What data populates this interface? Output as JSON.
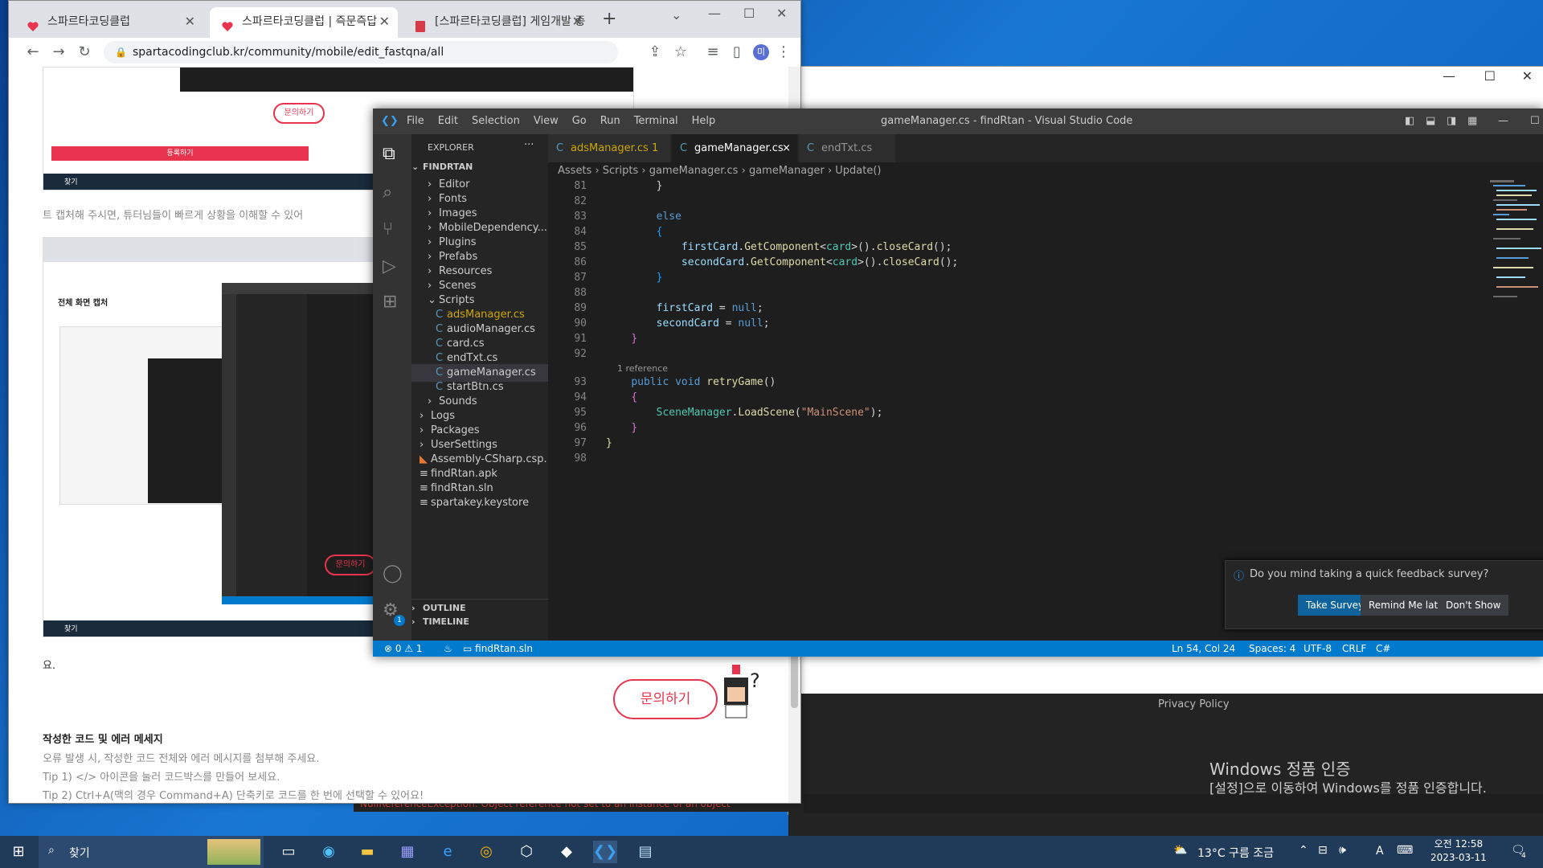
{
  "browser": {
    "tabs": [
      {
        "title": "스파르타코딩클럽"
      },
      {
        "title": "스파르타코딩클럽 | 즉문즉답"
      },
      {
        "title": "[스파르타코딩클럽] 게임개발 종"
      }
    ],
    "new_tab": "+",
    "url": "spartacodingclub.kr/community/mobile/edit_fastqna/all",
    "profile_initial": "미"
  },
  "page": {
    "caption_text": "트 캡처해 주시면, 튜터님들이 빠르게 상황을 이해할 수 있어",
    "small_inquiry": "문의하기",
    "register_button": "등록하기",
    "fragment_text": "요.",
    "inquiry_button": "문의하기",
    "section_title": "작성한 코드 및 에러 메세지",
    "lines": [
      "오류 발생 시, 작성한 코드 전체와 에러 메시지를 첨부해 주세요.",
      "Tip 1) </> 아이콘을 눌러 코드박스를 만들어 보세요.",
      "Tip 2) Ctrl+A(맥의 경우 Command+A) 단축키로 코드를 한 번에 선택할 수 있어요!"
    ],
    "nested_shot_title": "전체 화면 캡처",
    "mini_search": "찾기"
  },
  "vscode": {
    "title": "gameManager.cs - findRtan - Visual Studio Code",
    "menu": [
      "File",
      "Edit",
      "Selection",
      "View",
      "Go",
      "Run",
      "Terminal",
      "Help"
    ],
    "explorer_label": "EXPLORER",
    "explorer_more": "···",
    "project": "FINDRTAN",
    "tree": [
      {
        "label": "Editor",
        "indent": 2,
        "type": "folder"
      },
      {
        "label": "Fonts",
        "indent": 2,
        "type": "folder"
      },
      {
        "label": "Images",
        "indent": 2,
        "type": "folder"
      },
      {
        "label": "MobileDependency...",
        "indent": 2,
        "type": "folder"
      },
      {
        "label": "Plugins",
        "indent": 2,
        "type": "folder"
      },
      {
        "label": "Prefabs",
        "indent": 2,
        "type": "folder"
      },
      {
        "label": "Resources",
        "indent": 2,
        "type": "folder"
      },
      {
        "label": "Scenes",
        "indent": 2,
        "type": "folder"
      },
      {
        "label": "Scripts",
        "indent": 2,
        "type": "open-folder"
      },
      {
        "label": "adsManager.cs",
        "indent": 3,
        "type": "cs",
        "badge": "1"
      },
      {
        "label": "audioManager.cs",
        "indent": 3,
        "type": "cs"
      },
      {
        "label": "card.cs",
        "indent": 3,
        "type": "cs"
      },
      {
        "label": "endTxt.cs",
        "indent": 3,
        "type": "cs"
      },
      {
        "label": "gameManager.cs",
        "indent": 3,
        "type": "cs",
        "selected": true
      },
      {
        "label": "startBtn.cs",
        "indent": 3,
        "type": "cs"
      },
      {
        "label": "Sounds",
        "indent": 2,
        "type": "folder"
      },
      {
        "label": "Logs",
        "indent": 1,
        "type": "folder"
      },
      {
        "label": "Packages",
        "indent": 1,
        "type": "folder"
      },
      {
        "label": "UserSettings",
        "indent": 1,
        "type": "folder"
      },
      {
        "label": "Assembly-CSharp.csp...",
        "indent": 1,
        "type": "rss"
      },
      {
        "label": "findRtan.apk",
        "indent": 1,
        "type": "file"
      },
      {
        "label": "findRtan.sln",
        "indent": 1,
        "type": "file"
      },
      {
        "label": "spartakey.keystore",
        "indent": 1,
        "type": "file"
      }
    ],
    "outline": "OUTLINE",
    "timeline": "TIMELINE",
    "tabs": [
      {
        "label": "adsManager.cs",
        "badge": "1"
      },
      {
        "label": "gameManager.cs",
        "active": true,
        "close": "×"
      },
      {
        "label": "endTxt.cs"
      }
    ],
    "breadcrumb": [
      "Assets",
      "Scripts",
      "gameManager.cs",
      "gameManager",
      "Update()"
    ],
    "code_lines": [
      {
        "n": "81",
        "html": "        }"
      },
      {
        "n": "82",
        "html": ""
      },
      {
        "n": "83",
        "html": "        <span class='kw'>else</span>"
      },
      {
        "n": "84",
        "html": "        <span class='br2'>{</span>"
      },
      {
        "n": "85",
        "html": "            <span class='var'>firstCard</span>.<span class='fn'>GetComponent</span>&lt;<span class='ty'>card</span>&gt;().<span class='fn'>closeCard</span>();"
      },
      {
        "n": "86",
        "html": "            <span class='var'>secondCard</span>.<span class='fn'>GetComponent</span>&lt;<span class='ty'>card</span>&gt;().<span class='fn'>closeCard</span>();"
      },
      {
        "n": "87",
        "html": "        <span class='br2'>}</span>"
      },
      {
        "n": "88",
        "html": ""
      },
      {
        "n": "89",
        "html": "        <span class='var'>firstCard</span> = <span class='kw'>null</span>;"
      },
      {
        "n": "90",
        "html": "        <span class='var'>secondCard</span> = <span class='kw'>null</span>;"
      },
      {
        "n": "91",
        "html": "    <span class='br'>}</span>"
      },
      {
        "n": "92",
        "html": ""
      },
      {
        "n": "93",
        "html": "    <span class='kw'>public</span> <span class='kw'>void</span> <span class='fn'>retryGame</span>()",
        "ref": "1 reference"
      },
      {
        "n": "94",
        "html": "    <span class='br'>{</span>"
      },
      {
        "n": "95",
        "html": "        <span class='ty'>SceneManager</span>.<span class='fn'>LoadScene</span>(<span class='str'>\"MainScene\"</span>);"
      },
      {
        "n": "96",
        "html": "    <span class='br'>}</span>"
      },
      {
        "n": "97",
        "html": "<span class='fn'>}</span>"
      },
      {
        "n": "98",
        "html": ""
      }
    ],
    "toast": {
      "message": "Do you mind taking a quick feedback survey?",
      "take": "Take Survey",
      "remind": "Remind Me later",
      "dont": "Don't Show"
    },
    "status": {
      "errors": "0",
      "warnings": "1",
      "solution": "findRtan.sln",
      "position": "Ln 54, Col 24",
      "spaces": "Spaces: 4",
      "encoding": "UTF-8",
      "eol": "CRLF",
      "lang": "C#"
    },
    "notification_count": "1"
  },
  "background": {
    "privacy": "Privacy Policy",
    "watermark_title": "Windows 정품 인증",
    "watermark_sub": "[설정]으로 이동하여 Windows를 정품 인증합니다.",
    "error": "NullReferenceException: Object reference not set to an instance of an object"
  },
  "taskbar": {
    "search": "찾기",
    "weather": "13°C  구름 조금",
    "ime": "A",
    "time": "오전 12:58",
    "date": "2023-03-11",
    "notif_count": "4"
  },
  "colors": {
    "accent": "#007acc",
    "brand": "#e8344e"
  }
}
